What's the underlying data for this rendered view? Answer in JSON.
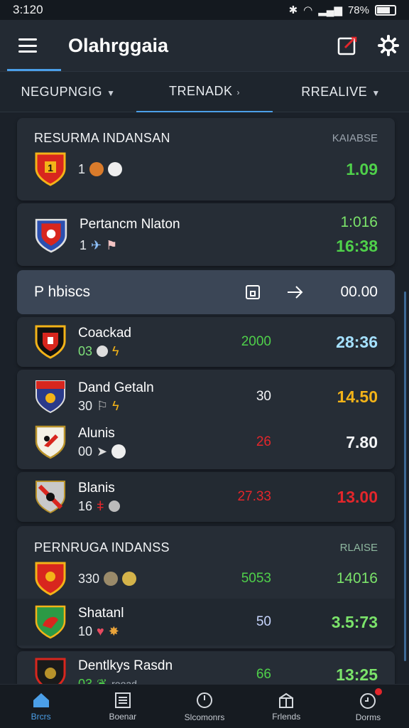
{
  "status": {
    "time": "3:120",
    "battery": "78%"
  },
  "header": {
    "title": "Olahrggaia"
  },
  "filters": [
    {
      "label": "NEGUPNGIG"
    },
    {
      "label": "TRENADK"
    },
    {
      "label": "RREALIVE"
    }
  ],
  "section1": {
    "title": "RESURMA INDANSAN",
    "tag": "KAIABSE",
    "rows": [
      {
        "name": "",
        "stat": "1",
        "mid": "",
        "odds": "1.09"
      },
      {
        "name": "Pertancm Nlaton",
        "stat": "1",
        "mid": "",
        "odds_top": "1:016",
        "odds": "16:38"
      }
    ]
  },
  "highlight": {
    "label": "P hbiscs",
    "value": "00.00"
  },
  "section2": {
    "rows": [
      {
        "name": "Coackad",
        "stat": "03",
        "mid": "2000",
        "odds": "28:36"
      },
      {
        "name": "Dand Getaln",
        "stat": "30",
        "mid": "30",
        "odds": "14.50"
      },
      {
        "name": "Alunis",
        "stat": "00",
        "mid": "26",
        "odds": "7.80"
      },
      {
        "name": "Blanis",
        "stat": "16",
        "mid": "27.33",
        "odds": "13.00"
      }
    ]
  },
  "section3": {
    "title": "PERNRUGA INDANSS",
    "tag": "RLAISE",
    "rows": [
      {
        "name": "",
        "stat": "330",
        "mid": "5053",
        "odds": "14016"
      },
      {
        "name": "Shatanl",
        "stat": "10",
        "mid": "50",
        "odds": "3.5:73"
      },
      {
        "name": "Dentlkys Rasdn",
        "stat": "03",
        "stat_extra": "rooad",
        "mid": "66",
        "odds": "13:25"
      }
    ]
  },
  "nav": [
    {
      "label": "Brcrs"
    },
    {
      "label": "Boenar"
    },
    {
      "label": "Slcomonrs"
    },
    {
      "label": "Frlends"
    },
    {
      "label": "Dorms"
    }
  ],
  "colors": {
    "accent": "#4b9fe8",
    "green": "#4fd04a",
    "amber": "#f3b318",
    "red": "#e3262b"
  }
}
